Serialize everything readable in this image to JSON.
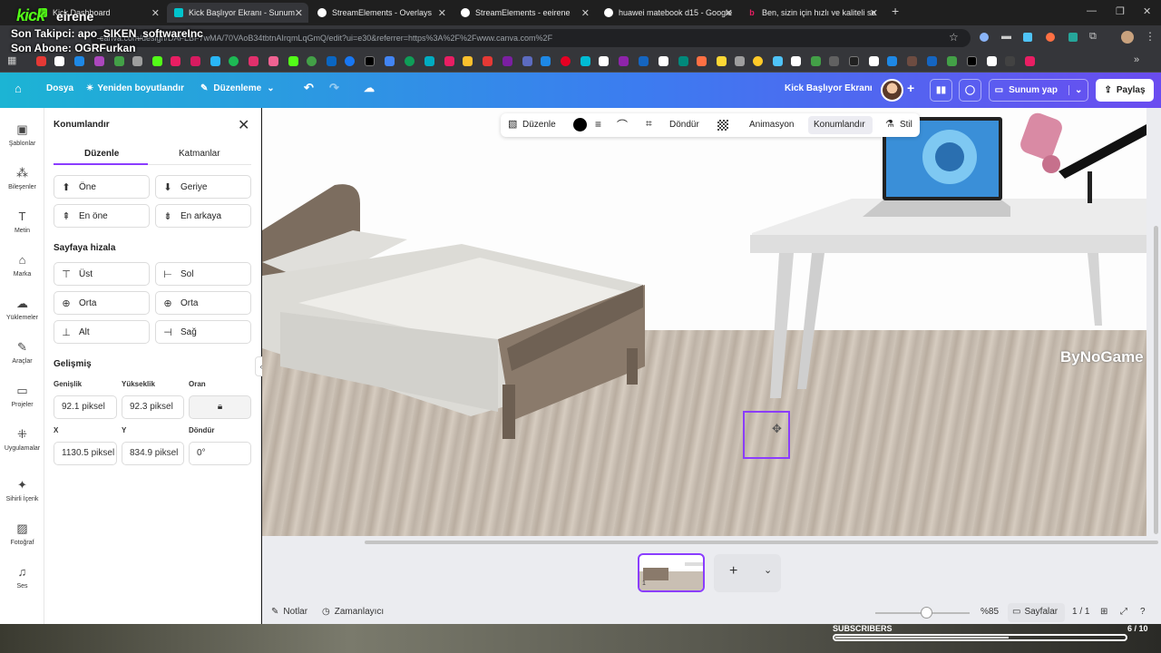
{
  "browser": {
    "tabs": [
      {
        "label": "Kick Dashboard",
        "active": false
      },
      {
        "label": "Kick Başlıyor Ekranı - Sunum",
        "active": true
      },
      {
        "label": "StreamElements - Overlays",
        "active": false
      },
      {
        "label": "StreamElements - eeirene",
        "active": false
      },
      {
        "label": "huawei matebook d15 - Google",
        "active": false
      },
      {
        "label": "Ben, sizin için hızlı ve kaliteli se",
        "active": false
      }
    ],
    "url": "canva.com/design/DAFLBF7wMA/70VAoB34tbtnAIrqmLqGmQ/edit?ui=e30&referrer=https%3A%2F%2Fwww.canva.com%2F"
  },
  "stream_overlay": {
    "brand": "kick",
    "channel": "eirene",
    "last_follower": "Son Takipci: apo_SIKEN_softwareInc",
    "last_sub": "Son Abone: OGRFurkan",
    "subscribers_label": "SUBSCRIBERS",
    "subscribers_count": "6 / 10",
    "subscribers_progress": 0.6
  },
  "header": {
    "file": "Dosya",
    "resize": "Yeniden boyutlandır",
    "edit_mode": "Düzenleme",
    "doc_title": "Kick Başlıyor Ekranı",
    "present": "Sunum yap",
    "share": "Paylaş"
  },
  "rail": [
    {
      "label": "Şablonlar",
      "icon": "templates-icon"
    },
    {
      "label": "Bileşenler",
      "icon": "elements-icon"
    },
    {
      "label": "Metin",
      "icon": "text-icon"
    },
    {
      "label": "Marka",
      "icon": "brand-icon"
    },
    {
      "label": "Yüklemeler",
      "icon": "uploads-icon"
    },
    {
      "label": "Araçlar",
      "icon": "tools-icon"
    },
    {
      "label": "Projeler",
      "icon": "projects-icon"
    },
    {
      "label": "Uygulamalar",
      "icon": "apps-icon"
    },
    {
      "label": "Sihirli İçerik",
      "icon": "magic-icon"
    },
    {
      "label": "Fotoğraf",
      "icon": "photo-icon"
    },
    {
      "label": "Ses",
      "icon": "audio-icon"
    }
  ],
  "panel": {
    "title": "Konumlandır",
    "tab_arrange": "Düzenle",
    "tab_layers": "Katmanlar",
    "forward": "Öne",
    "backward": "Geriye",
    "to_front": "En öne",
    "to_back": "En arkaya",
    "align_title": "Sayfaya hizala",
    "align_top": "Üst",
    "align_left": "Sol",
    "align_middle": "Orta",
    "align_center": "Orta",
    "align_bottom": "Alt",
    "align_right": "Sağ",
    "advanced_title": "Gelişmiş",
    "width_label": "Genişlik",
    "height_label": "Yükseklik",
    "ratio_label": "Oran",
    "width_value": "92.1 piksel",
    "height_value": "92.3 piksel",
    "x_label": "X",
    "y_label": "Y",
    "rotate_label": "Döndür",
    "x_value": "1130.5 piksel",
    "y_value": "834.9 piksel",
    "rotate_value": "0°"
  },
  "canvas_toolbar": {
    "edit": "Düzenle",
    "rotate": "Döndür",
    "animate": "Animasyon",
    "position": "Konumlandır",
    "style": "Stil"
  },
  "canvas": {
    "watermark": "ByNoGame"
  },
  "pages": {
    "current_page_number": "1",
    "notes": "Notlar",
    "timer": "Zamanlayıcı",
    "zoom": "%85",
    "pages_label": "Sayfalar",
    "page_count": "1 / 1"
  },
  "colors": {
    "accent": "#8b3dff",
    "header_start": "#1cb4d4",
    "header_end": "#6a4cf0",
    "kick_green": "#53fc18"
  }
}
